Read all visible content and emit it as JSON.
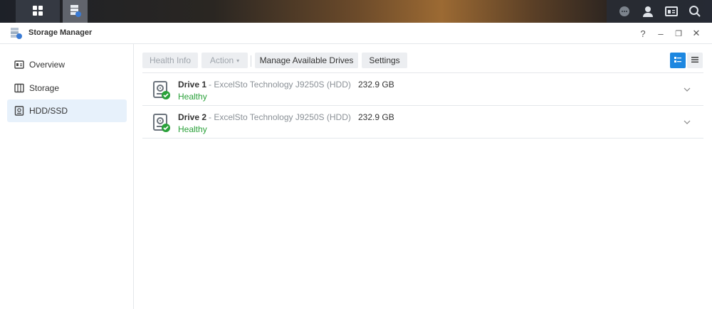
{
  "window": {
    "title": "Storage Manager"
  },
  "window_controls": {
    "help": "?",
    "minimize": "–",
    "restore": "❐",
    "close": "✕"
  },
  "sidebar": {
    "items": [
      {
        "label": "Overview",
        "icon": "overview-icon",
        "active": false
      },
      {
        "label": "Storage",
        "icon": "storage-icon",
        "active": false
      },
      {
        "label": "HDD/SSD",
        "icon": "hdd-icon",
        "active": true
      }
    ]
  },
  "toolbar": {
    "health_info_label": "Health Info",
    "action_label": "Action",
    "action_caret": "▾",
    "manage_drives_label": "Manage Available Drives",
    "settings_label": "Settings"
  },
  "drives": [
    {
      "name": "Drive 1",
      "model": " - ExcelSto Technology J9250S (HDD)",
      "size": "232.9 GB",
      "status": "Healthy"
    },
    {
      "name": "Drive 2",
      "model": " - ExcelSto Technology J9250S (HDD)",
      "size": "232.9 GB",
      "status": "Healthy"
    }
  ],
  "colors": {
    "accent": "#1d87e0",
    "healthy": "#2aa13a",
    "active_nav_bg": "#e7f1fb"
  }
}
